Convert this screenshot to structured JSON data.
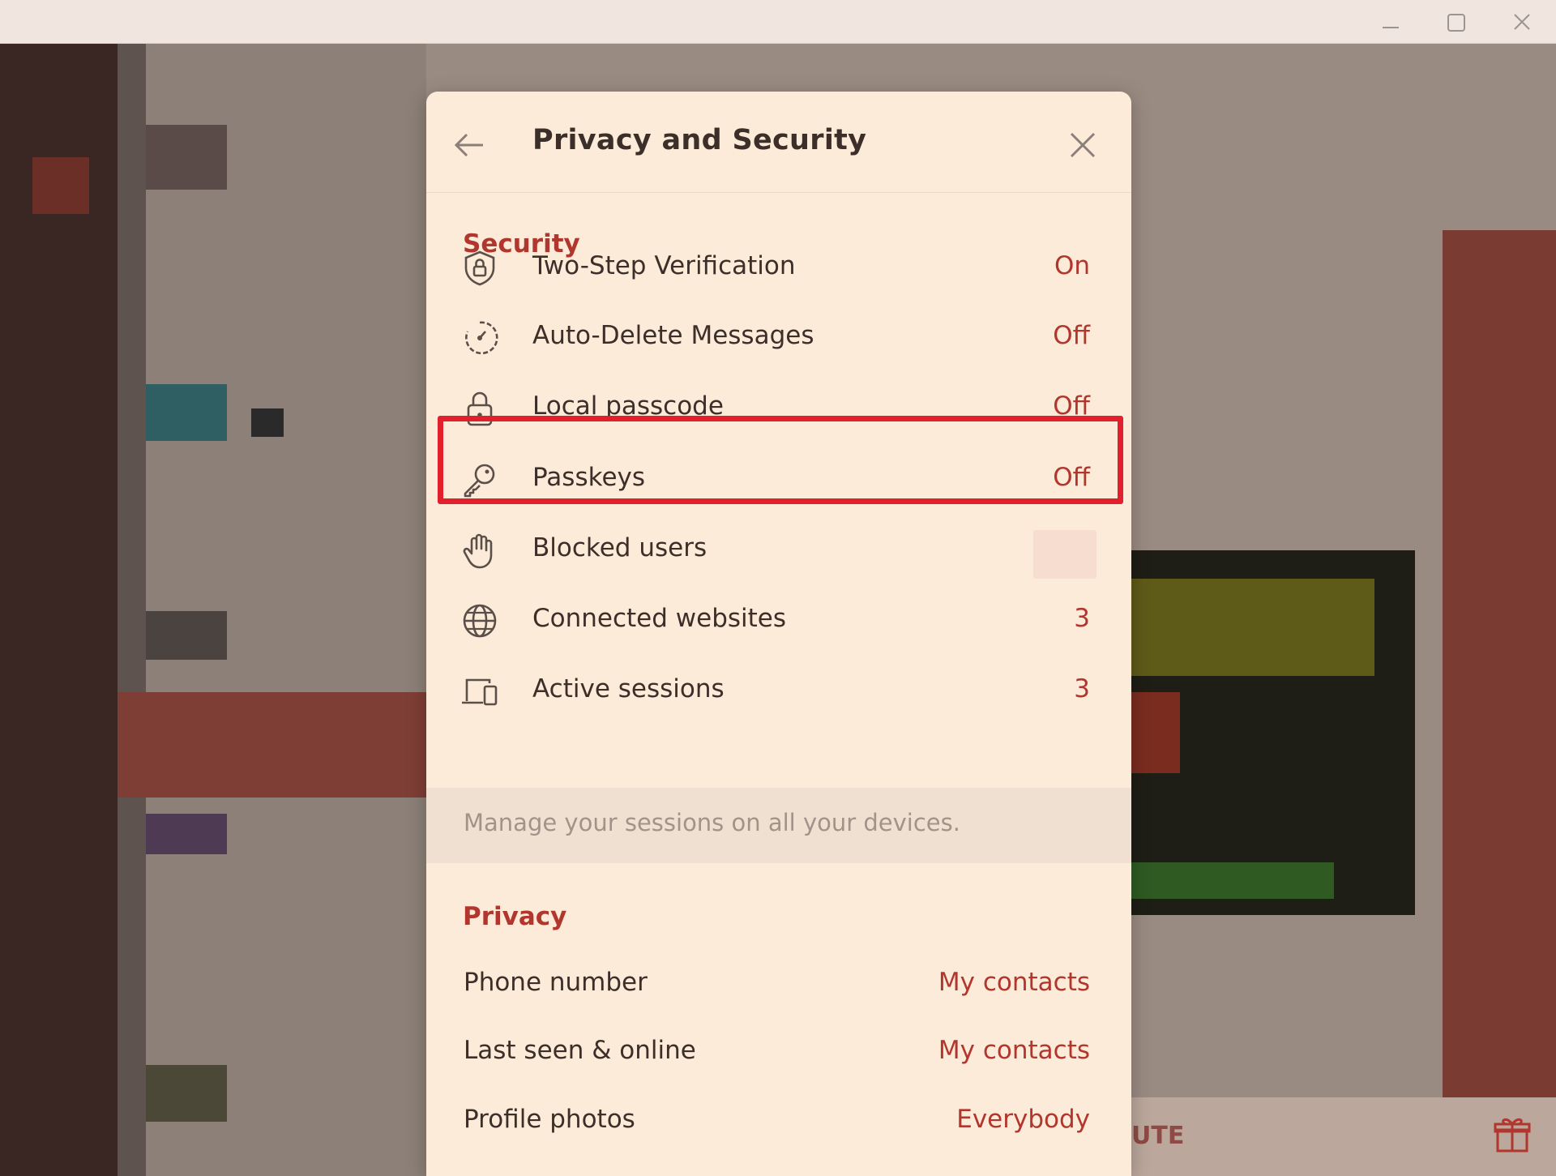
{
  "window": {
    "minimize_icon": "minimize-icon",
    "maximize_icon": "maximize-icon",
    "close_icon": "close-icon"
  },
  "background": {
    "partial_text": "UTE",
    "gift_icon": "gift-icon"
  },
  "dialog": {
    "title": "Privacy and Security",
    "back_icon": "arrow-left-icon",
    "close_icon": "close-icon",
    "security": {
      "heading": "Security",
      "items": [
        {
          "label": "Two-Step Verification",
          "value": "On",
          "icon": "shield-lock-icon"
        },
        {
          "label": "Auto-Delete Messages",
          "value": "Off",
          "icon": "timer-icon"
        },
        {
          "label": "Local passcode",
          "value": "Off",
          "icon": "lock-icon"
        },
        {
          "label": "Passkeys",
          "value": "Off",
          "icon": "key-icon"
        },
        {
          "label": "Blocked users",
          "value": "",
          "icon": "hand-icon"
        },
        {
          "label": "Connected websites",
          "value": "3",
          "icon": "globe-icon"
        },
        {
          "label": "Active sessions",
          "value": "3",
          "icon": "devices-icon"
        }
      ],
      "note": "Manage your sessions on all your devices."
    },
    "privacy": {
      "heading": "Privacy",
      "items": [
        {
          "label": "Phone number",
          "value": "My contacts"
        },
        {
          "label": "Last seen & online",
          "value": "My contacts"
        },
        {
          "label": "Profile photos",
          "value": "Everybody"
        }
      ]
    }
  },
  "colors": {
    "accent": "#b1362d",
    "highlight": "#e21f2d",
    "dialog_bg": "#fdebd9"
  }
}
